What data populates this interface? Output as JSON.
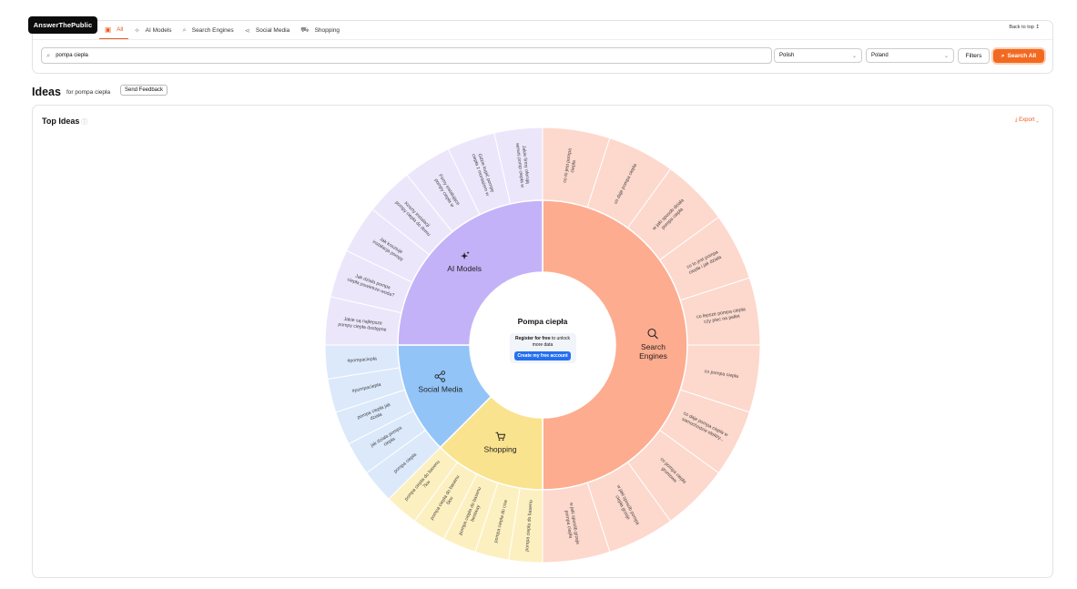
{
  "logo": "AnswerThePublic",
  "tabs": [
    {
      "label": "All",
      "icon": "grid-icon",
      "active": true
    },
    {
      "label": "AI Models",
      "icon": "sparkle-icon",
      "active": false
    },
    {
      "label": "Search Engines",
      "icon": "search-icon",
      "active": false
    },
    {
      "label": "Social Media",
      "icon": "share-icon",
      "active": false
    },
    {
      "label": "Shopping",
      "icon": "cart-icon",
      "active": false
    }
  ],
  "back_to_top": "Back to top",
  "search": {
    "value": "pompa ciepła"
  },
  "language": "Polish",
  "country": "Poland",
  "filters_label": "Filters",
  "search_all_label": "Search All",
  "ideas": {
    "title": "Ideas",
    "for_text": "for pompa ciepła",
    "feedback_label": "Send Feedback"
  },
  "top_ideas": {
    "title": "Top Ideas",
    "export_label": "Export"
  },
  "center": {
    "title": "Pompa ciepła",
    "register_bold": "Register for free",
    "register_rest": " to unlock more data",
    "cta": "Create my free account"
  },
  "colors": {
    "accent": "#f26a21",
    "search_engines": "#fdac8f",
    "ai_models": "#c4b2f8",
    "social_media": "#93c4f7",
    "shopping": "#fae38e",
    "cta": "#2570ee"
  },
  "segments": [
    {
      "name": "Search Engines",
      "icon": "search-icon",
      "start": 0,
      "end": 180,
      "fill": "#fdac8f",
      "outer": "#fdd8cd",
      "ideas": [
        "co to jest pompa ciepła",
        "co daje pompa ciepła",
        "w jaki sposób działa pompa ciepła",
        "co to jest pompa ciepła i jak działa",
        "co lepsze pompa ciepła czy piec na pellet",
        "co pompa ciepła",
        "co daje pompa ciepła w samochodzie elektry...",
        "co pompa ciepła gruntowa",
        "w jaki sposób pompa ciepła grzeje",
        "w jaki sposób grzeje pompa ciepła"
      ]
    },
    {
      "name": "Shopping",
      "icon": "cart-icon",
      "start": 180,
      "end": 225,
      "fill": "#fae38e",
      "outer": "#fdf0c0",
      "ideas": [
        "pompa ciepła do basenu",
        "pompa ciepła do ccw",
        "pompa ciepła do basenu bestway",
        "pompa ciepła do basenu 5kw",
        "pompa ciepła do basenu 7kw"
      ]
    },
    {
      "name": "Social Media",
      "icon": "share-icon",
      "start": 225,
      "end": 270,
      "fill": "#93c4f7",
      "outer": "#dbe9fb",
      "ideas": [
        "pompa ciepła",
        "jak działa pompa ciepła",
        "pompa ciepła jak działa",
        "#pompaciepła",
        "#pompaciepła"
      ]
    },
    {
      "name": "AI Models",
      "icon": "sparkle-icon",
      "start": 270,
      "end": 360,
      "fill": "#c4b2f8",
      "outer": "#ece6fb",
      "ideas": [
        "Jakie są najlepsze pompy ciepła dostępne ...",
        "Jak działa pompa ciepła powietrze-woda?",
        "Jak kosztuje instalacja pompy ciepła w domu ...",
        "Koszty instalacji pompy ciepła do domu ...",
        "Firmy instalujące pompy ciepła w Warszawie",
        "Gdzie kupić pompę ciepła z montażem w W...",
        "Jakie firmy oferują serwis pomp ciepła w Krakowie"
      ]
    }
  ]
}
